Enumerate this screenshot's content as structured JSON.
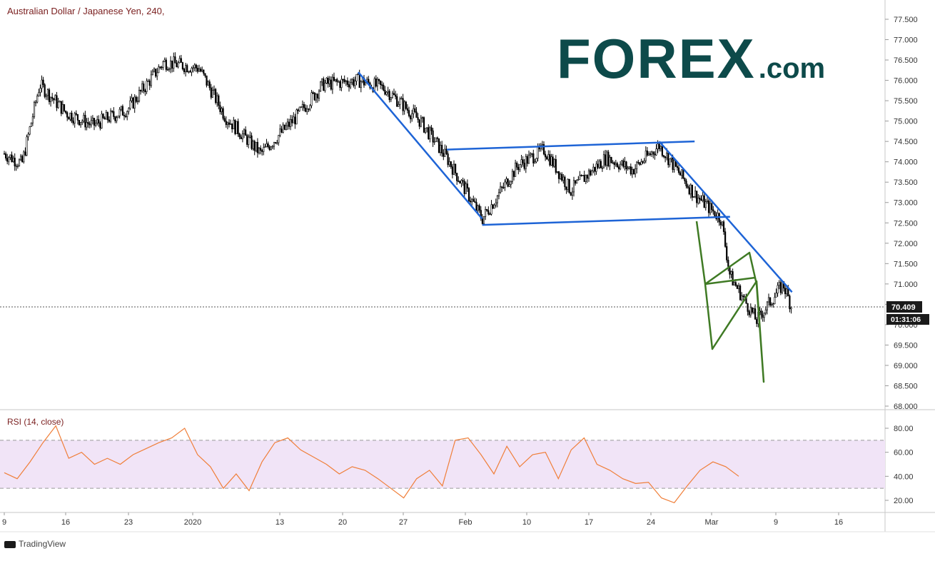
{
  "header": {
    "title": "Australian Dollar / Japanese Yen, 240,"
  },
  "rsi": {
    "title": "RSI (14, close)"
  },
  "logo": {
    "main": "FOREX",
    "suffix": ".com"
  },
  "footer": {
    "brand": "TradingView"
  },
  "price_badges": {
    "last_price": "70.409",
    "countdown": "01:31:06"
  },
  "colors": {
    "trendline_blue": "#1e64d6",
    "flag_green": "#3f7a24",
    "rsi_line": "#f07f3a",
    "rsi_band": "#f1e4f7",
    "candle": "#000000"
  },
  "chart_data": [
    {
      "type": "candlestick",
      "title": "Australian Dollar / Japanese Yen, 240,",
      "x_ticks": [
        "9",
        "16",
        "23",
        "2020",
        "13",
        "20",
        "27",
        "Feb",
        "10",
        "17",
        "24",
        "Mar",
        "9",
        "16"
      ],
      "y_ticks": [
        "68.000",
        "68.500",
        "69.000",
        "69.500",
        "70.000",
        "70.500",
        "71.000",
        "71.500",
        "72.000",
        "72.500",
        "73.000",
        "73.500",
        "74.000",
        "74.500",
        "75.000",
        "75.500",
        "76.000",
        "76.500",
        "77.000",
        "77.500"
      ],
      "ylim": [
        68.0,
        77.5
      ],
      "last_price": 70.409,
      "approx_price_path": [
        {
          "x": "Dec 9",
          "y": 74.2
        },
        {
          "x": "Dec 11",
          "y": 73.95
        },
        {
          "x": "Dec 13",
          "y": 75.9
        },
        {
          "x": "Dec 16",
          "y": 75.2
        },
        {
          "x": "Dec 19",
          "y": 74.9
        },
        {
          "x": "Dec 23",
          "y": 75.3
        },
        {
          "x": "Dec 27",
          "y": 76.45
        },
        {
          "x": "Dec 31",
          "y": 76.3
        },
        {
          "x": "Jan 2",
          "y": 75.1
        },
        {
          "x": "Jan 6",
          "y": 74.2
        },
        {
          "x": "Jan 10",
          "y": 75.1
        },
        {
          "x": "Jan 13",
          "y": 75.9
        },
        {
          "x": "Jan 17",
          "y": 76.0
        },
        {
          "x": "Jan 20",
          "y": 75.8
        },
        {
          "x": "Jan 24",
          "y": 75.0
        },
        {
          "x": "Jan 27",
          "y": 74.1
        },
        {
          "x": "Jan 31",
          "y": 72.6
        },
        {
          "x": "Feb 4",
          "y": 73.9
        },
        {
          "x": "Feb 7",
          "y": 74.3
        },
        {
          "x": "Feb 10",
          "y": 73.3
        },
        {
          "x": "Feb 14",
          "y": 74.1
        },
        {
          "x": "Feb 17",
          "y": 73.8
        },
        {
          "x": "Feb 20",
          "y": 74.4
        },
        {
          "x": "Feb 24",
          "y": 73.2
        },
        {
          "x": "Feb 27",
          "y": 72.6
        },
        {
          "x": "Feb 28",
          "y": 71.2
        },
        {
          "x": "Mar 2",
          "y": 70.1
        },
        {
          "x": "Mar 5",
          "y": 71.0
        },
        {
          "x": "Mar 6",
          "y": 70.41
        }
      ],
      "annotations": [
        {
          "type": "trendline",
          "color": "blue",
          "from": {
            "x": "Jan 17",
            "y": 76.2
          },
          "to": {
            "x": "Jan 31",
            "y": 72.6
          }
        },
        {
          "type": "channel-upper",
          "color": "blue",
          "from": {
            "x": "Jan 27",
            "y": 74.3
          },
          "to": {
            "x": "Feb 24",
            "y": 74.5
          }
        },
        {
          "type": "channel-lower",
          "color": "blue",
          "from": {
            "x": "Jan 31",
            "y": 72.45
          },
          "to": {
            "x": "Feb 28",
            "y": 72.65
          }
        },
        {
          "type": "trendline",
          "color": "blue",
          "from": {
            "x": "Feb 20",
            "y": 74.5
          },
          "to": {
            "x": "Mar 6",
            "y": 70.8
          }
        },
        {
          "type": "pennant",
          "color": "green"
        }
      ]
    },
    {
      "type": "line",
      "title": "RSI (14, close)",
      "y_ticks": [
        "20.00",
        "40.00",
        "60.00",
        "80.00"
      ],
      "ylim": [
        13,
        90
      ],
      "bands": [
        30,
        70
      ],
      "values": [
        43,
        38,
        52,
        68,
        82,
        55,
        60,
        50,
        55,
        50,
        58,
        63,
        68,
        72,
        80,
        58,
        48,
        30,
        42,
        28,
        52,
        68,
        72,
        62,
        56,
        50,
        42,
        48,
        45,
        38,
        30,
        22,
        38,
        45,
        32,
        70,
        72,
        58,
        42,
        65,
        48,
        58,
        60,
        38,
        62,
        72,
        50,
        45,
        38,
        34,
        35,
        22,
        18,
        32,
        45,
        52,
        48,
        40
      ]
    }
  ]
}
